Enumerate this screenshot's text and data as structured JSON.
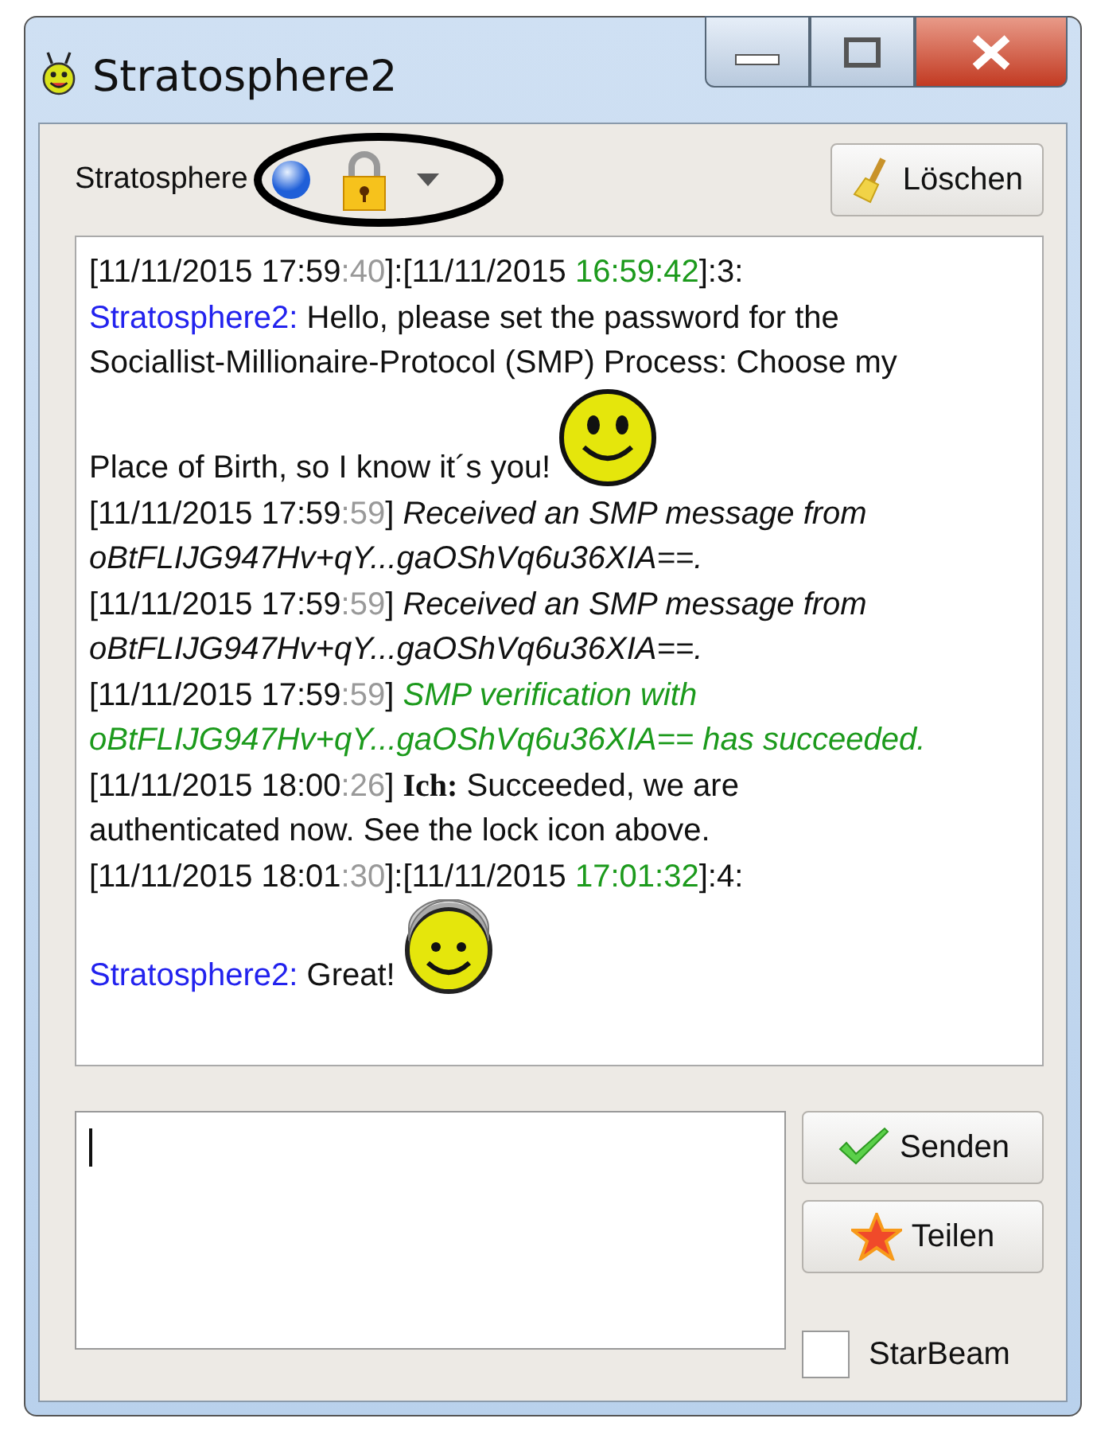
{
  "window": {
    "title": "Stratosphere2"
  },
  "toolbar": {
    "contact_label": "Stratosphere",
    "encrypted": true,
    "clear_button": "Löschen"
  },
  "log": [
    [
      {
        "text": "[11/11/2015 17:59",
        "kind": "plain"
      },
      {
        "text": ":40",
        "kind": "grey"
      },
      {
        "text": "]:[11/11/2015 ",
        "kind": "plain"
      },
      {
        "text": "16:59:42",
        "kind": "green"
      },
      {
        "text": "]:3:",
        "kind": "plain"
      }
    ],
    [
      {
        "text": "Stratosphere2:",
        "kind": "blue"
      },
      {
        "text": " Hello, please set the password for the",
        "kind": "plain"
      }
    ],
    [
      {
        "text": "Sociallist-Millionaire-Protocol (SMP) Process: Choose my",
        "kind": "plain"
      }
    ],
    [
      {
        "text": "Place of Birth, so I know it´s you!",
        "kind": "plain"
      },
      {
        "kind": "smiley"
      }
    ],
    [
      {
        "text": "[11/11/2015 17:59",
        "kind": "plain"
      },
      {
        "text": ":59",
        "kind": "grey"
      },
      {
        "text": "] ",
        "kind": "plain"
      },
      {
        "text": "Received an SMP message from",
        "kind": "italic"
      }
    ],
    [
      {
        "text": "oBtFLIJG947Hv+qY...gaOShVq6u36XIA==.",
        "kind": "italic"
      }
    ],
    [
      {
        "text": "[11/11/2015 17:59",
        "kind": "plain"
      },
      {
        "text": ":59",
        "kind": "grey"
      },
      {
        "text": "] ",
        "kind": "plain"
      },
      {
        "text": "Received an SMP message from",
        "kind": "italic"
      }
    ],
    [
      {
        "text": "oBtFLIJG947Hv+qY...gaOShVq6u36XIA==.",
        "kind": "italic"
      }
    ],
    [
      {
        "text": "[11/11/2015 17:59",
        "kind": "plain"
      },
      {
        "text": ":59",
        "kind": "grey"
      },
      {
        "text": "] ",
        "kind": "plain"
      },
      {
        "text": "SMP verification with",
        "kind": "italic_green"
      }
    ],
    [
      {
        "text": "oBtFLIJG947Hv+qY...gaOShVq6u36XIA== has succeeded.",
        "kind": "italic_green"
      }
    ],
    [
      {
        "text": "[11/11/2015 18:00",
        "kind": "plain"
      },
      {
        "text": ":26",
        "kind": "grey"
      },
      {
        "text": "] ",
        "kind": "plain"
      },
      {
        "text": "Ich:",
        "kind": "bold"
      },
      {
        "text": " Succeeded, we are",
        "kind": "plain"
      }
    ],
    [
      {
        "text": "authenticated now. See the lock icon above.",
        "kind": "plain"
      }
    ],
    [
      {
        "text": "[11/11/2015 18:01",
        "kind": "plain"
      },
      {
        "text": ":30",
        "kind": "grey"
      },
      {
        "text": "]:[11/11/2015 ",
        "kind": "plain"
      },
      {
        "text": "17:01:32",
        "kind": "green"
      },
      {
        "text": "]:4:",
        "kind": "plain"
      }
    ],
    [
      {
        "text": "Stratosphere2:",
        "kind": "blue"
      },
      {
        "text": " Great!",
        "kind": "plain"
      },
      {
        "kind": "helmet"
      }
    ]
  ],
  "send_button": "Senden",
  "share_button": "Teilen",
  "starbeam": {
    "label": "StarBeam",
    "checked": false
  }
}
